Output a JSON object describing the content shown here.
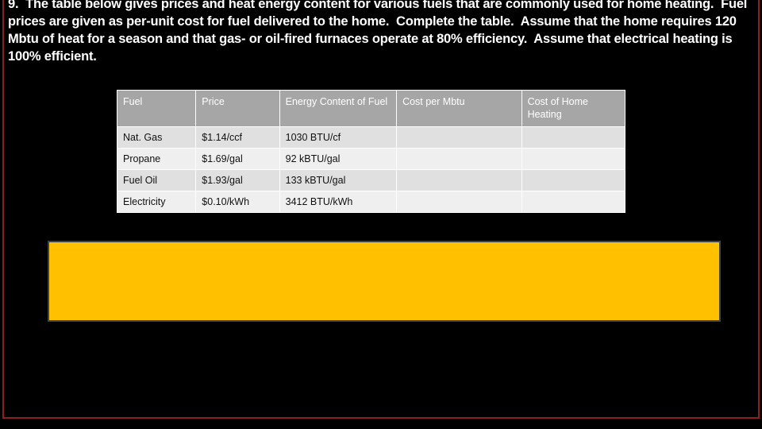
{
  "slide": {
    "background_color": "#000000",
    "frame_color": "#8B2020",
    "prompt": "9.  The table below gives prices and heat energy content for various fuels that are commonly used for home heating.  Fuel prices are given as per-unit cost for fuel delivered to the home.  Complete the table.  Assume that the home requires 120 Mbtu of heat for a season and that gas- or oil-fired furnaces operate at 80% efficiency.  Assume that electrical heating is 100% efficient."
  },
  "table": {
    "header_background": "#a6a6a6",
    "header_text_color": "#ffffff",
    "columns": [
      "Fuel",
      "Price",
      "Energy Content of Fuel",
      "Cost per Mbtu",
      "Cost of Home Heating"
    ],
    "rows": [
      {
        "fuel": "Nat. Gas",
        "price": "$1.14/ccf",
        "energy_content": "1030 BTU/cf",
        "cost_per_mbtu": "",
        "cost_of_home_heating": ""
      },
      {
        "fuel": "Propane",
        "price": "$1.69/gal",
        "energy_content": "92 kBTU/gal",
        "cost_per_mbtu": "",
        "cost_of_home_heating": ""
      },
      {
        "fuel": "Fuel Oil",
        "price": "$1.93/gal",
        "energy_content": "133 kBTU/gal",
        "cost_per_mbtu": "",
        "cost_of_home_heating": ""
      },
      {
        "fuel": "Electricity",
        "price": "$0.10/kWh",
        "energy_content": "3412 BTU/kWh",
        "cost_per_mbtu": "",
        "cost_of_home_heating": ""
      }
    ]
  },
  "answer_box": {
    "content": "",
    "fill_color": "#FFC000",
    "border_color": "#3a4550"
  }
}
